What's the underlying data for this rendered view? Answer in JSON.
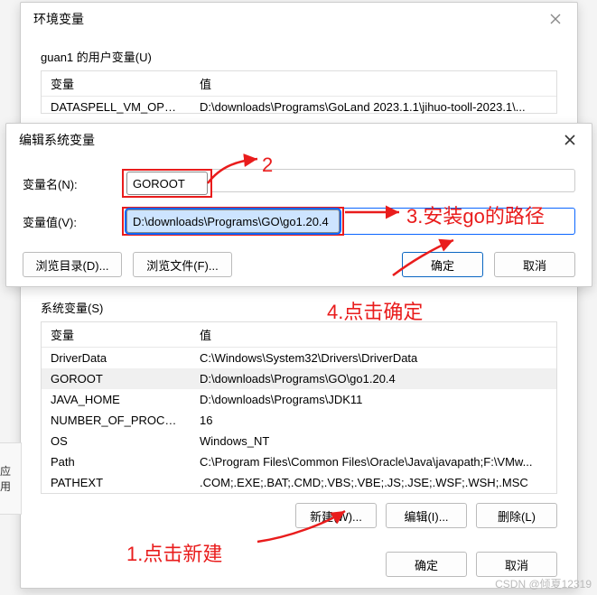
{
  "env_window": {
    "title": "环境变量",
    "user_vars_label": "guan1 的用户变量(U)",
    "cols": {
      "name": "变量",
      "value": "值"
    },
    "user_rows": [
      {
        "name": "DATASPELL_VM_OPTIONS",
        "value": "D:\\downloads\\Programs\\GoLand 2023.1.1\\jihuo-tooll-2023.1\\..."
      }
    ],
    "sys_vars_label": "系统变量(S)",
    "sys_rows": [
      {
        "name": "DriverData",
        "value": "C:\\Windows\\System32\\Drivers\\DriverData"
      },
      {
        "name": "GOROOT",
        "value": "D:\\downloads\\Programs\\GO\\go1.20.4",
        "selected": true
      },
      {
        "name": "JAVA_HOME",
        "value": "D:\\downloads\\Programs\\JDK11"
      },
      {
        "name": "NUMBER_OF_PROCESSORS",
        "value": "16"
      },
      {
        "name": "OS",
        "value": "Windows_NT"
      },
      {
        "name": "Path",
        "value": "C:\\Program Files\\Common Files\\Oracle\\Java\\javapath;F:\\VMw..."
      },
      {
        "name": "PATHEXT",
        "value": ".COM;.EXE;.BAT;.CMD;.VBS;.VBE;.JS;.JSE;.WSF;.WSH;.MSC"
      }
    ],
    "btn_new": "新建(W)...",
    "btn_edit": "编辑(I)...",
    "btn_delete": "删除(L)",
    "btn_ok": "确定",
    "btn_cancel": "取消"
  },
  "edit_window": {
    "title": "编辑系统变量",
    "name_label": "变量名(N):",
    "name_value": "GOROOT",
    "value_label": "变量值(V):",
    "value_value": "D:\\downloads\\Programs\\GO\\go1.20.4",
    "btn_browse_dir": "浏览目录(D)...",
    "btn_browse_file": "浏览文件(F)...",
    "btn_ok": "确定",
    "btn_cancel": "取消"
  },
  "annotations": {
    "a1": "1.点击新建",
    "a2": "2",
    "a3": "3.安装go的路径",
    "a4": "4.点击确定"
  },
  "left_tab": "应用",
  "watermark": "CSDN @倾夏12319"
}
